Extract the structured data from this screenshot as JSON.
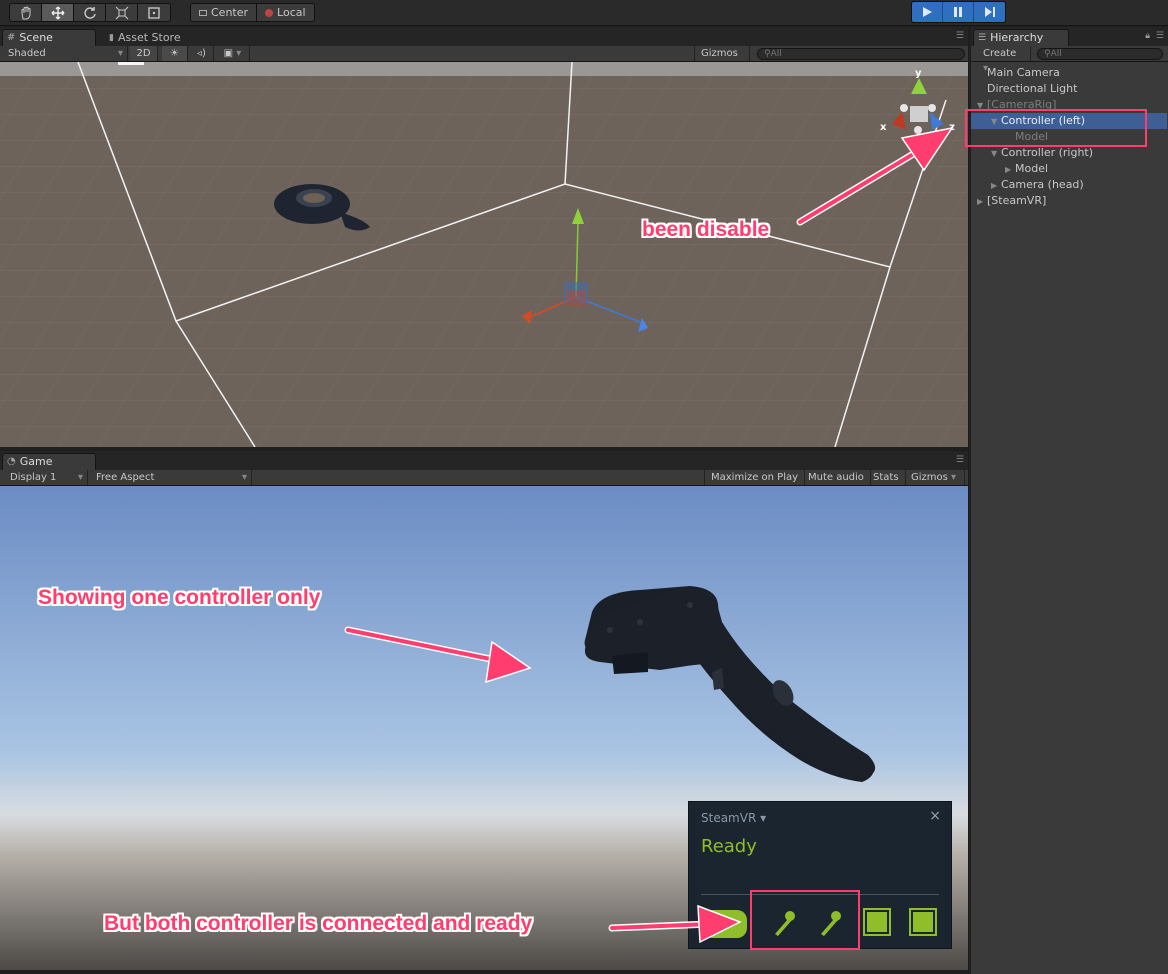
{
  "toolbar": {
    "pivot_center": "Center",
    "pivot_local": "Local"
  },
  "scene": {
    "tab_label": "Scene",
    "asset_store_label": "Asset Store",
    "shading_mode": "Shaded",
    "mode_2d": "2D",
    "gizmos_label": "Gizmos",
    "search_placeholder": "All",
    "axis_y": "y",
    "axis_x": "x",
    "axis_z": "z"
  },
  "game": {
    "tab_label": "Game",
    "display": "Display 1",
    "aspect": "Free Aspect",
    "maximize_on_play": "Maximize on Play",
    "mute_audio": "Mute audio",
    "stats": "Stats",
    "gizmos_label": "Gizmos"
  },
  "hierarchy": {
    "tab_label": "Hierarchy",
    "create_label": "Create",
    "search_placeholder": "All",
    "items": [
      {
        "label": "Main Camera",
        "indent": 0,
        "arrow": "",
        "state": "normal"
      },
      {
        "label": "Directional Light",
        "indent": 0,
        "arrow": "",
        "state": "normal"
      },
      {
        "label": "[CameraRig]",
        "indent": 0,
        "arrow": "down",
        "state": "disabled"
      },
      {
        "label": "Controller (left)",
        "indent": 1,
        "arrow": "down",
        "state": "selected"
      },
      {
        "label": "Model",
        "indent": 2,
        "arrow": "",
        "state": "disabled"
      },
      {
        "label": "Controller (right)",
        "indent": 1,
        "arrow": "down",
        "state": "normal"
      },
      {
        "label": "Model",
        "indent": 2,
        "arrow": "right",
        "state": "normal"
      },
      {
        "label": "Camera (head)",
        "indent": 1,
        "arrow": "right",
        "state": "normal"
      },
      {
        "label": "[SteamVR]",
        "indent": 0,
        "arrow": "right",
        "state": "normal"
      }
    ]
  },
  "steamvr": {
    "title": "SteamVR",
    "status": "Ready",
    "close_symbol": "×",
    "devices": [
      "headset-icon",
      "controller-icon",
      "controller-icon",
      "base-station-icon",
      "base-station-icon"
    ]
  },
  "annotations": {
    "disabled_note": "been disable",
    "game_note": "Showing one controller only",
    "connected_note": "But both controller is connected and ready"
  },
  "colors": {
    "selection": "#3e5f96",
    "steamvr_green": "#8fbe2a",
    "annotation_pink": "#ff3d6e",
    "play_blue": "#2f6fc0"
  }
}
